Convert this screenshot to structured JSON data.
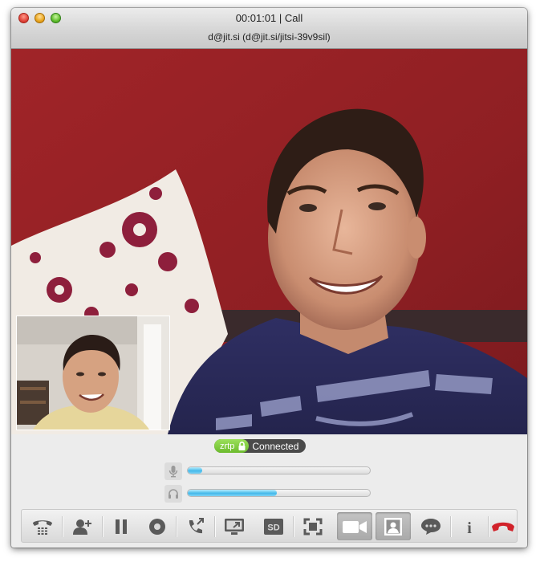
{
  "window": {
    "title": "00:01:01 | Call",
    "subtitle": "d@jit.si (d@jit.si/jitsi-39v9sil)"
  },
  "security": {
    "protocol": "zrtp",
    "status": "Connected",
    "protocol_color": "#7ac943"
  },
  "levels": {
    "microphone_level": 0.08,
    "speaker_level": 0.49,
    "fill_color": "#45b9ea"
  },
  "toolbar": {
    "buttons": [
      {
        "id": "dialpad",
        "icon": "dialpad-phone-icon"
      },
      {
        "id": "add-participant",
        "icon": "add-user-icon"
      },
      {
        "id": "hold",
        "icon": "pause-icon"
      },
      {
        "id": "record",
        "icon": "record-icon"
      },
      {
        "id": "transfer",
        "icon": "transfer-call-icon"
      },
      {
        "id": "desktop-sharing",
        "icon": "desktop-share-icon"
      },
      {
        "id": "quality",
        "icon": "sd-icon",
        "label": "SD"
      },
      {
        "id": "fullscreen",
        "icon": "fullscreen-icon"
      },
      {
        "id": "video",
        "icon": "video-camera-icon",
        "active": true
      },
      {
        "id": "local-video",
        "icon": "local-video-icon",
        "active": true
      },
      {
        "id": "chat",
        "icon": "chat-bubble-icon"
      },
      {
        "id": "info",
        "icon": "info-icon",
        "label": "i"
      },
      {
        "id": "hangup",
        "icon": "hangup-icon"
      }
    ],
    "hangup_color": "#d1222a"
  }
}
